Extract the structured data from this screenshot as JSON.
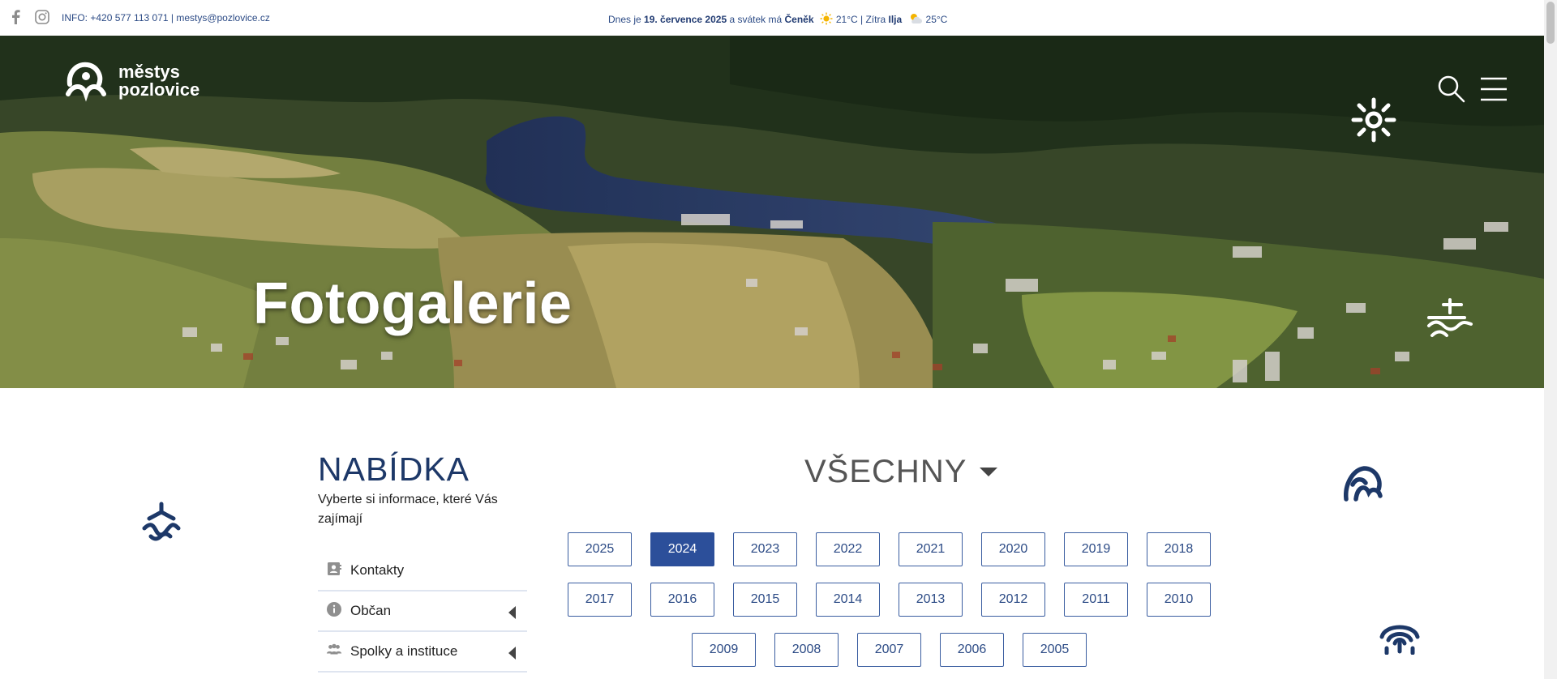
{
  "topbar": {
    "contact": "INFO: +420 577 113 071 | mestys@pozlovice.cz",
    "today_prefix": "Dnes je ",
    "today_date": "19. července 2025",
    "today_mid": " a svátek má ",
    "today_name": "Čeněk",
    "today_temp": "21°C | Zítra ",
    "tomorrow_name": "Ilja",
    "tomorrow_temp": "25°C",
    "facebook_icon": "facebook-icon",
    "instagram_icon": "instagram-icon"
  },
  "header": {
    "logo_line1": "městys",
    "logo_line2": "pozlovice",
    "title": "Fotogalerie"
  },
  "sidebar": {
    "heading": "NABÍDKA",
    "subheading": "Vyberte si informace, které Vás zajímají",
    "items": [
      {
        "label": "Kontakty",
        "icon": "contact-card-icon",
        "has_submenu": false
      },
      {
        "label": "Občan",
        "icon": "info-icon",
        "has_submenu": true
      },
      {
        "label": "Spolky a instituce",
        "icon": "people-icon",
        "has_submenu": true
      }
    ]
  },
  "gallery": {
    "filter_label": "VŠECHNY",
    "active_year": "2024",
    "years": [
      "2025",
      "2024",
      "2023",
      "2022",
      "2021",
      "2020",
      "2019",
      "2018",
      "2017",
      "2016",
      "2015",
      "2014",
      "2013",
      "2012",
      "2011",
      "2010",
      "2009",
      "2008",
      "2007",
      "2006",
      "2005"
    ]
  },
  "colors": {
    "brand_navy": "#1d3868",
    "button_border": "#3a5da0",
    "active_button": "#2c4f9a"
  }
}
